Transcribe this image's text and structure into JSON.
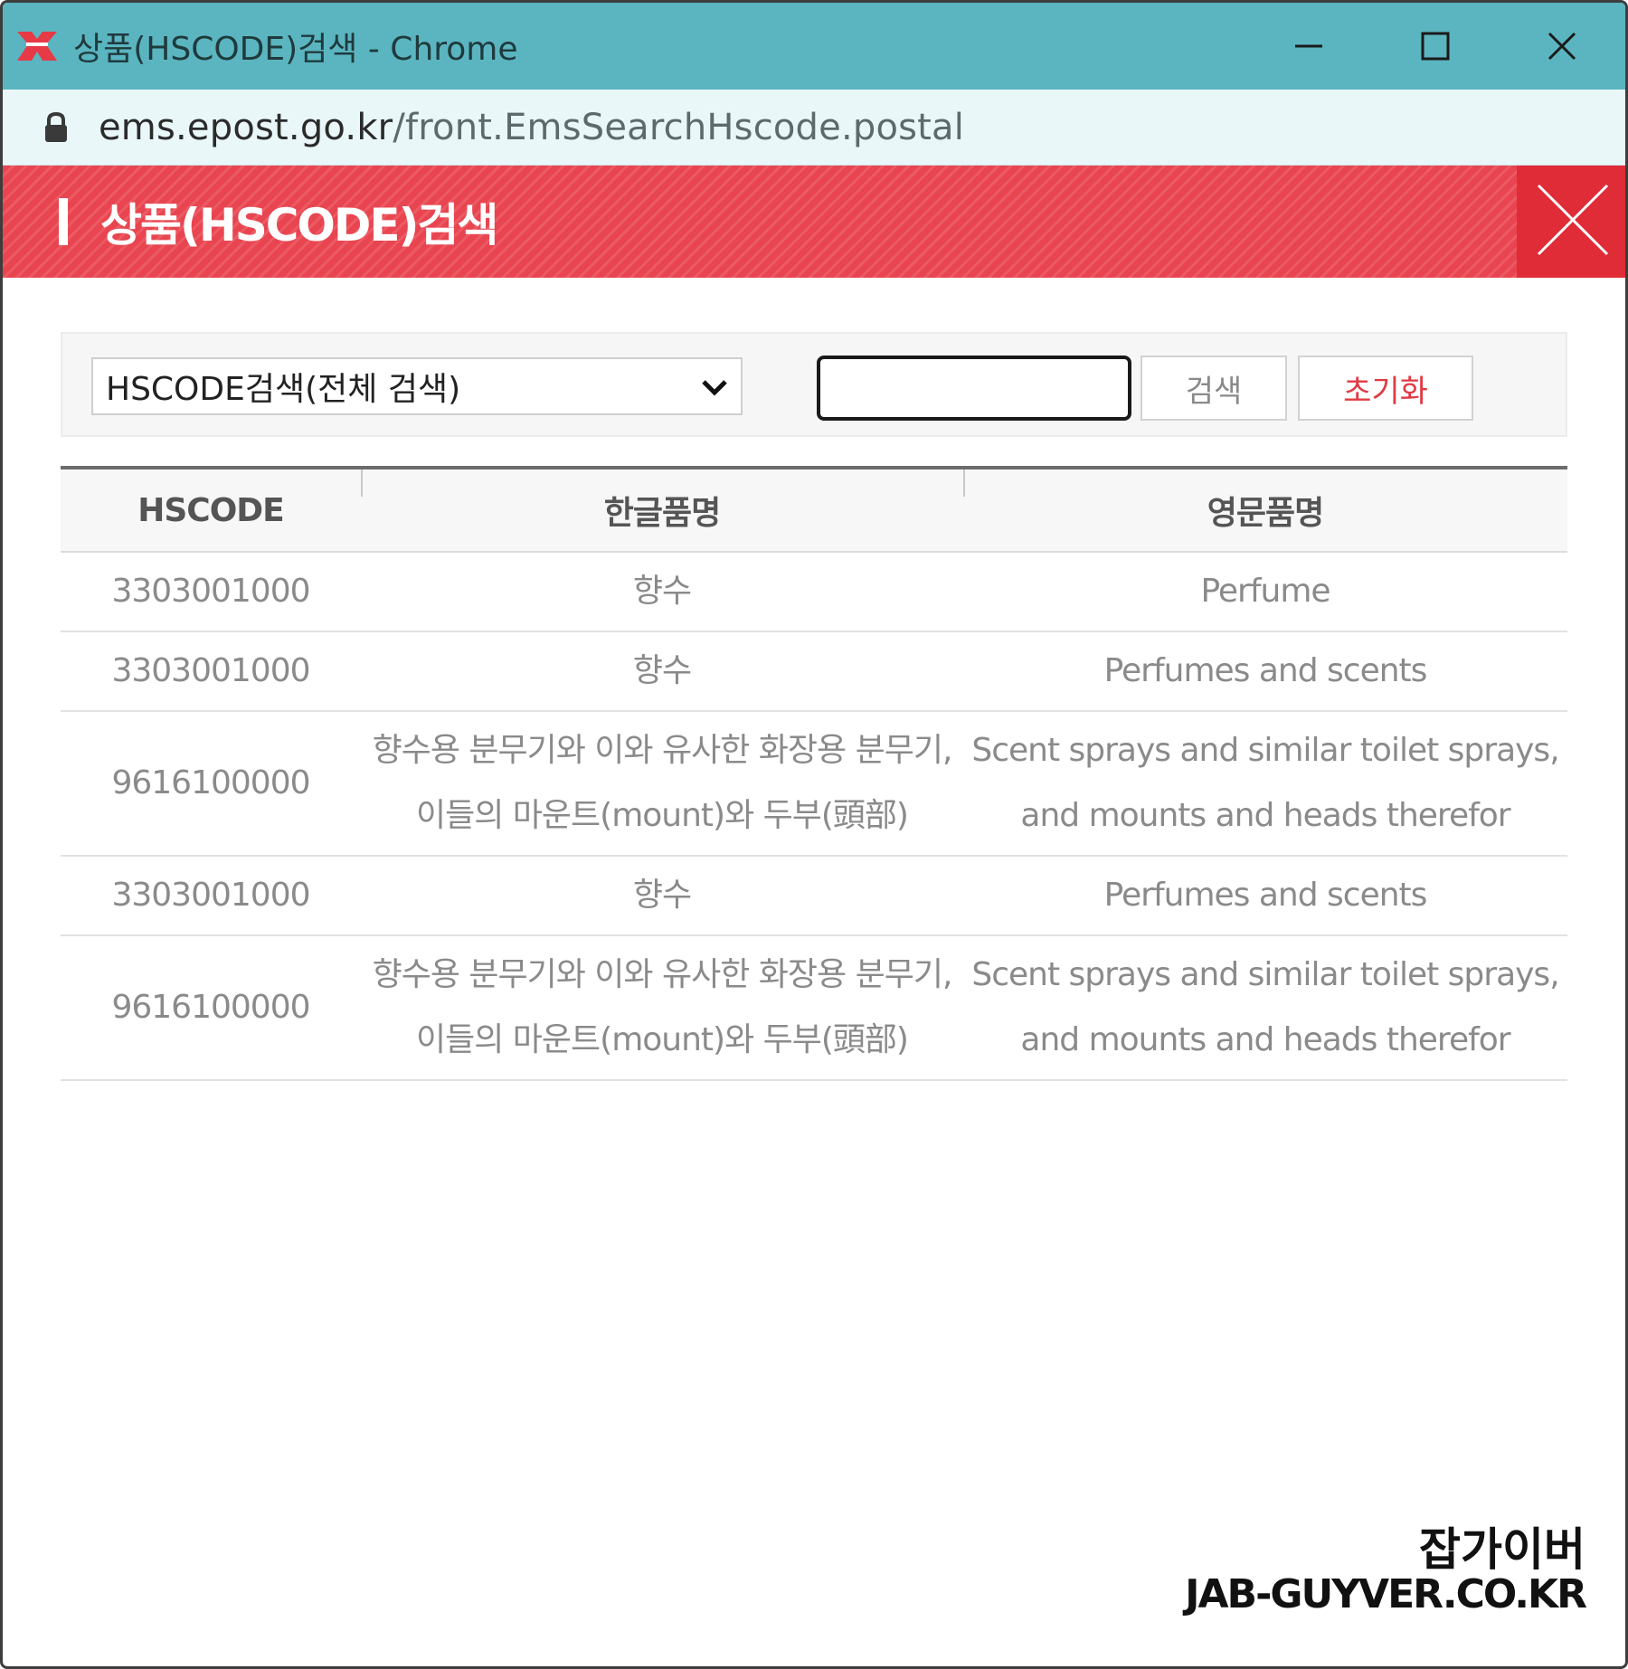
{
  "window": {
    "title": "상품(HSCODE)검색 - Chrome",
    "icon": "epost-logo-icon",
    "controls": [
      "minimize-icon",
      "maximize-icon",
      "close-icon"
    ]
  },
  "address_bar": {
    "host": "ems.epost.go.kr",
    "path": "/front.EmsSearchHscode.postal"
  },
  "modal": {
    "title": "상품(HSCODE)검색",
    "close_icon": "close-icon"
  },
  "search": {
    "select_value": "HSCODE검색(전체 검색)",
    "input_value": "",
    "search_label": "검색",
    "reset_label": "초기화"
  },
  "table": {
    "headers": [
      "HSCODE",
      "한글품명",
      "영문품명"
    ],
    "rows": [
      {
        "code": "3303001000",
        "ko": "향수",
        "en": "Perfume"
      },
      {
        "code": "3303001000",
        "ko": "향수",
        "en": "Perfumes and scents"
      },
      {
        "code": "9616100000",
        "ko": "향수용 분무기와 이와 유사한 화장용 분무기,\n이들의 마운트(mount)와 두부(頭部)",
        "en": "Scent sprays and similar toilet sprays,\nand mounts and heads therefor"
      },
      {
        "code": "3303001000",
        "ko": "향수",
        "en": "Perfumes and scents"
      },
      {
        "code": "9616100000",
        "ko": "향수용 분무기와 이와 유사한 화장용 분무기,\n이들의 마운트(mount)와 두부(頭部)",
        "en": "Scent sprays and similar toilet sprays,\nand mounts and heads therefor"
      }
    ]
  },
  "watermark": {
    "line1": "잡가이버",
    "line2": "JAB-GUYVER.CO.KR"
  },
  "colors": {
    "titlebar": "#5bb5c0",
    "addressbar": "#e9f7f8",
    "header_red": "#e84550",
    "close_red": "#e02c37",
    "reset_text": "#e03a44"
  }
}
